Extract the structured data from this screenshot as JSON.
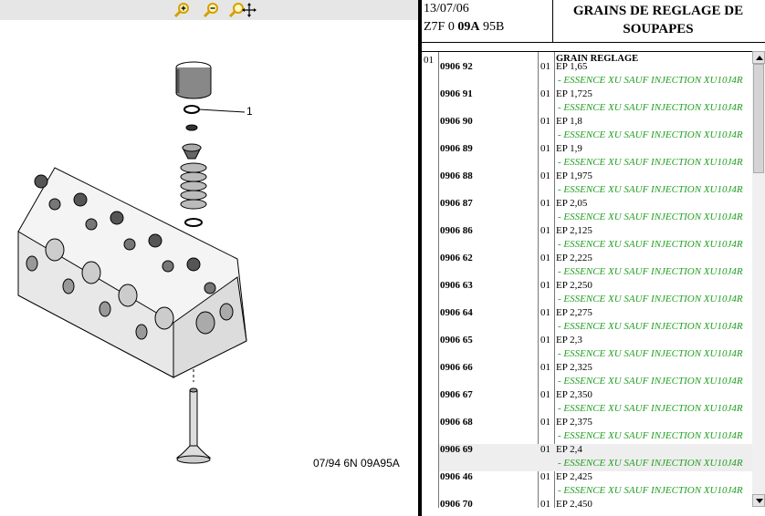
{
  "toolbar": {
    "zoom_in": "zoom-in-icon",
    "zoom_out": "zoom-out-icon",
    "pan": "zoom-pan-icon"
  },
  "drawing": {
    "reference": "07/94 6N 09A95A",
    "callout": "1"
  },
  "header": {
    "date": "13/07/06",
    "code_prefix": "Z7F 0 ",
    "code_bold": "09A",
    "code_suffix": " 95B",
    "title": "GRAINS DE REGLAGE DE SOUPAPES"
  },
  "list": {
    "group_number": "01",
    "group_title": "GRAIN REGLAGE",
    "note": "- ESSENCE XU SAUF INJECTION XU10J4R",
    "rows": [
      {
        "ref": "0906 92",
        "qty": "01",
        "desc": "EP 1,65"
      },
      {
        "ref": "0906 91",
        "qty": "01",
        "desc": "EP 1,725"
      },
      {
        "ref": "0906 90",
        "qty": "01",
        "desc": "EP 1,8"
      },
      {
        "ref": "0906 89",
        "qty": "01",
        "desc": "EP 1,9"
      },
      {
        "ref": "0906 88",
        "qty": "01",
        "desc": "EP 1,975"
      },
      {
        "ref": "0906 87",
        "qty": "01",
        "desc": "EP 2,05"
      },
      {
        "ref": "0906 86",
        "qty": "01",
        "desc": "EP 2,125"
      },
      {
        "ref": "0906 62",
        "qty": "01",
        "desc": "EP 2,225"
      },
      {
        "ref": "0906 63",
        "qty": "01",
        "desc": "EP 2,250"
      },
      {
        "ref": "0906 64",
        "qty": "01",
        "desc": "EP 2,275"
      },
      {
        "ref": "0906 65",
        "qty": "01",
        "desc": "EP 2,3"
      },
      {
        "ref": "0906 66",
        "qty": "01",
        "desc": "EP 2,325"
      },
      {
        "ref": "0906 67",
        "qty": "01",
        "desc": "EP 2,350"
      },
      {
        "ref": "0906 68",
        "qty": "01",
        "desc": "EP 2,375"
      },
      {
        "ref": "0906 69",
        "qty": "01",
        "desc": "EP 2,4"
      },
      {
        "ref": "0906 46",
        "qty": "01",
        "desc": "EP 2,425"
      },
      {
        "ref": "0906 70",
        "qty": "01",
        "desc": "EP 2,450"
      }
    ]
  },
  "colors": {
    "note_green": "#1f9e1f",
    "selected_row": "#eeeeee",
    "toolbar_bg": "#e6e6e6",
    "zoom_icon": "#d4a000"
  }
}
